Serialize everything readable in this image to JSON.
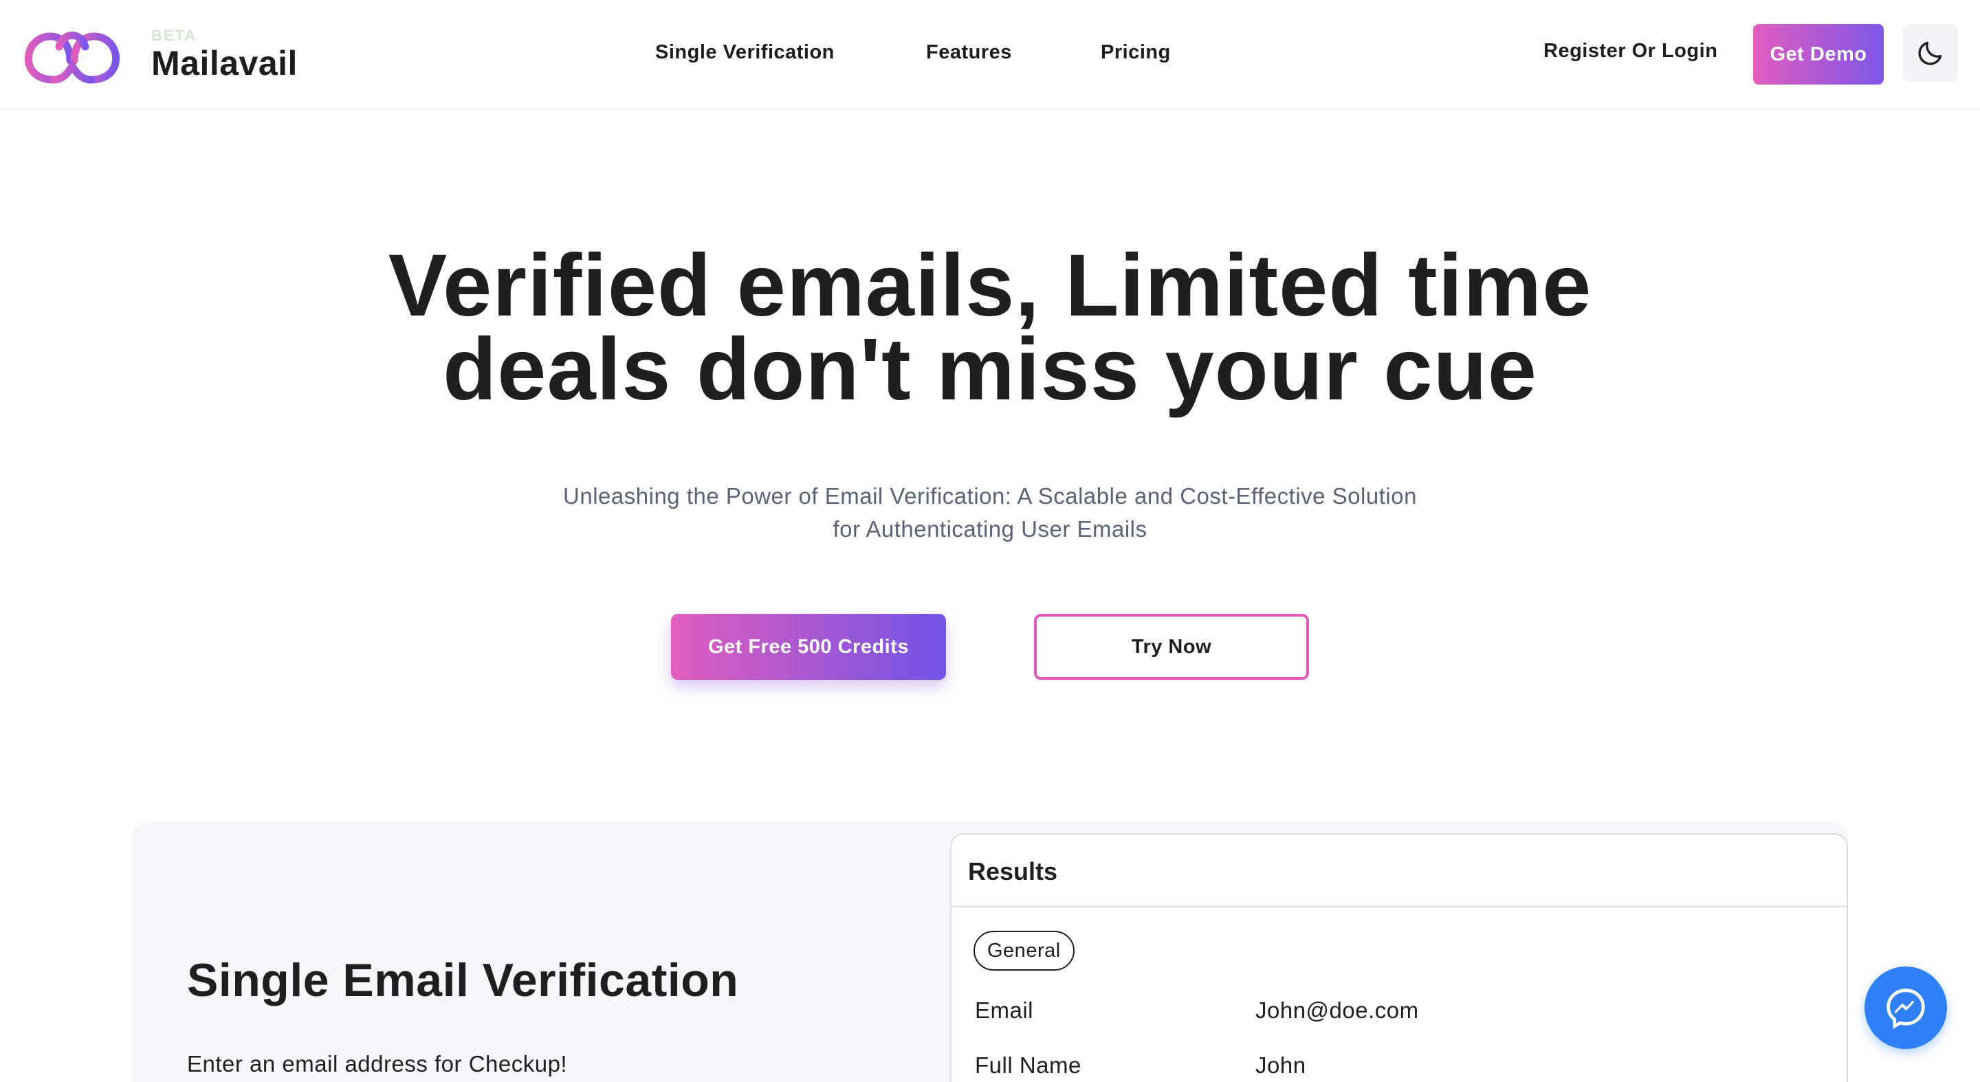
{
  "header": {
    "beta_badge": "BETA",
    "brand": "Mailavail",
    "nav": [
      {
        "label": "Single Verification"
      },
      {
        "label": "Features"
      },
      {
        "label": "Pricing"
      }
    ],
    "login_label": "Register Or Login",
    "demo_label": "Get Demo",
    "theme_icon": "moon-icon"
  },
  "hero": {
    "title_line1": "Verified emails, Limited time",
    "title_line2": "deals don't miss your cue",
    "subtitle_line1": "Unleashing the Power of Email Verification: A Scalable and Cost-Effective Solution",
    "subtitle_line2": "for Authenticating User Emails",
    "primary_cta": "Get Free 500 Credits",
    "secondary_cta": "Try Now"
  },
  "verification": {
    "title": "Single Email Verification",
    "description": "Enter an email address for Checkup!"
  },
  "results": {
    "title": "Results",
    "tab": "General",
    "rows": [
      {
        "label": "Email",
        "value": "John@doe.com"
      },
      {
        "label": "Full Name",
        "value": "John"
      }
    ]
  },
  "chat_icon": "messenger-icon",
  "colors": {
    "gradient_start": "#e15dbd",
    "gradient_end": "#7153e6",
    "outline_accent": "#e35ab8",
    "messenger_blue": "#2f80f6"
  }
}
